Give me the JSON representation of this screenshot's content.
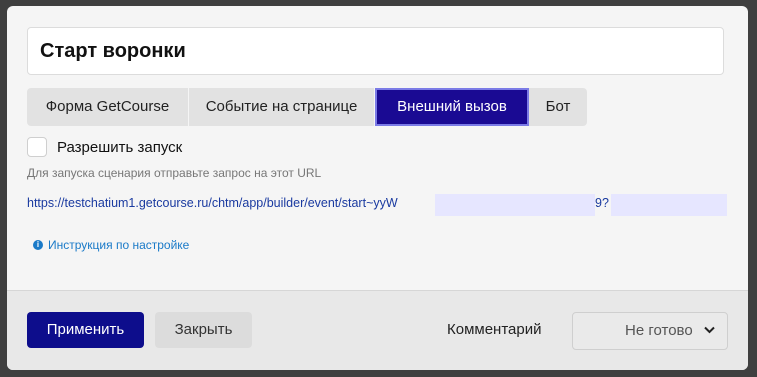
{
  "title": "Старт воронки",
  "tabs": [
    {
      "label": "Форма GetCourse",
      "active": false
    },
    {
      "label": "Событие на странице",
      "active": false
    },
    {
      "label": "Внешний вызов",
      "active": true
    },
    {
      "label": "Бот",
      "active": false
    }
  ],
  "allow_start": {
    "label": "Разрешить запуск",
    "checked": false
  },
  "hint": "Для запуска сценария отправьте запрос на этот URL",
  "url": {
    "prefix": "https://testchatium1.getcourse.ru/chtm/app/builder/event/start~yyW",
    "middle": "9?"
  },
  "help_link": "Инструкция по настройке",
  "footer": {
    "apply_label": "Применить",
    "close_label": "Закрыть",
    "comment_label": "Комментарий",
    "status_value": "Не готово"
  },
  "colors": {
    "accent": "#0d0d8c",
    "link": "#1a7ac8"
  }
}
